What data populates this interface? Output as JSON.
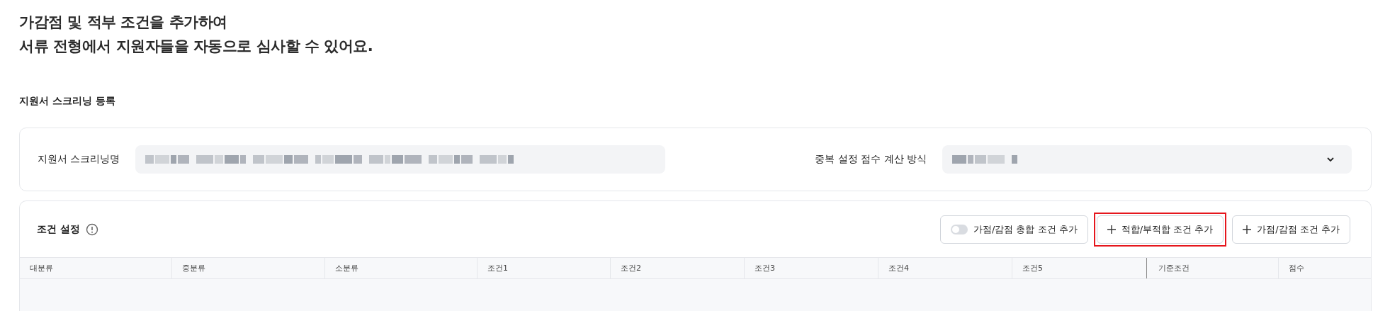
{
  "intro": [
    "가감점 및 적부 조건을 추가하여",
    "서류 전형에서 지원자들을 자동으로 심사할 수 있어요."
  ],
  "section_title": "지원서 스크리닝 등록",
  "form": {
    "name_label": "지원서 스크리닝명",
    "name_value": {
      "kind": "redacted"
    },
    "method_label": "중복 설정 점수 계산 방식",
    "method_value": {
      "kind": "redacted"
    }
  },
  "conditions": {
    "title": "조건 설정",
    "buttons": [
      {
        "kind": "toggle",
        "label": "가점/감점 총합 조건 추가",
        "on": false,
        "highlighted": false
      },
      {
        "kind": "add",
        "label": "적합/부적합 조건 추가",
        "highlighted": true
      },
      {
        "kind": "add",
        "label": "가점/감점 조건 추가",
        "highlighted": false
      }
    ],
    "columns": [
      "대분류",
      "중분류",
      "소분류",
      "조건1",
      "조건2",
      "조건3",
      "조건4",
      "조건5",
      "기준조건",
      "점수"
    ]
  }
}
